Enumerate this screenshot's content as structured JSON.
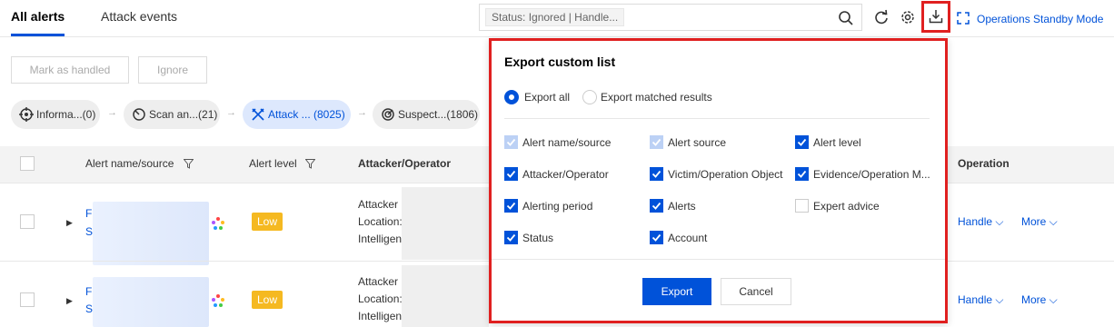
{
  "tabs": {
    "all_alerts": "All alerts",
    "attack_events": "Attack events"
  },
  "search": {
    "tag": "Status: Ignored | Handle..."
  },
  "toolbar": {
    "standby_mode": "Operations Standby Mode"
  },
  "actions": {
    "mark_handled": "Mark as handled",
    "ignore": "Ignore"
  },
  "steps": [
    {
      "label": "Informa...(0)",
      "icon": "crosshair-icon"
    },
    {
      "label": "Scan an...(21)",
      "icon": "scan-icon"
    },
    {
      "label": "Attack ...  (8025)",
      "icon": "attack-icon"
    },
    {
      "label": "Suspect...(1806)",
      "icon": "suspect-icon"
    }
  ],
  "table": {
    "headers": {
      "alert_name": "Alert name/source",
      "alert_level": "Alert level",
      "attacker": "Attacker/Operator",
      "operation": "Operation"
    },
    "rows": [
      {
        "name_prefix_1": "F",
        "name_prefix_2": "S",
        "level": "Low",
        "attacker_lines": [
          "Attacker",
          "Location:",
          "Intelligen"
        ],
        "handle": "Handle",
        "more": "More"
      },
      {
        "name_prefix_1": "F",
        "name_prefix_2": "S",
        "level": "Low",
        "attacker_lines": [
          "Attacker",
          "Location:",
          "Intelligen"
        ],
        "handle": "Handle",
        "more": "More"
      }
    ]
  },
  "export_panel": {
    "title": "Export custom list",
    "radio_all": "Export all",
    "radio_matched": "Export matched results",
    "fields": [
      {
        "label": "Alert name/source",
        "state": "disabled"
      },
      {
        "label": "Alert source",
        "state": "disabled"
      },
      {
        "label": "Alert level",
        "state": "checked"
      },
      {
        "label": "Attacker/Operator",
        "state": "checked"
      },
      {
        "label": "Victim/Operation Object",
        "state": "checked"
      },
      {
        "label": "Evidence/Operation M...",
        "state": "checked"
      },
      {
        "label": "Alerting period",
        "state": "checked"
      },
      {
        "label": "Alerts",
        "state": "checked"
      },
      {
        "label": "Expert advice",
        "state": "unchecked"
      },
      {
        "label": "Status",
        "state": "checked"
      },
      {
        "label": "Account",
        "state": "checked"
      }
    ],
    "export_button": "Export",
    "cancel_button": "Cancel"
  },
  "colors": {
    "primary": "#0052d9",
    "highlight_border": "#e02020",
    "low_badge": "#f5b921"
  }
}
